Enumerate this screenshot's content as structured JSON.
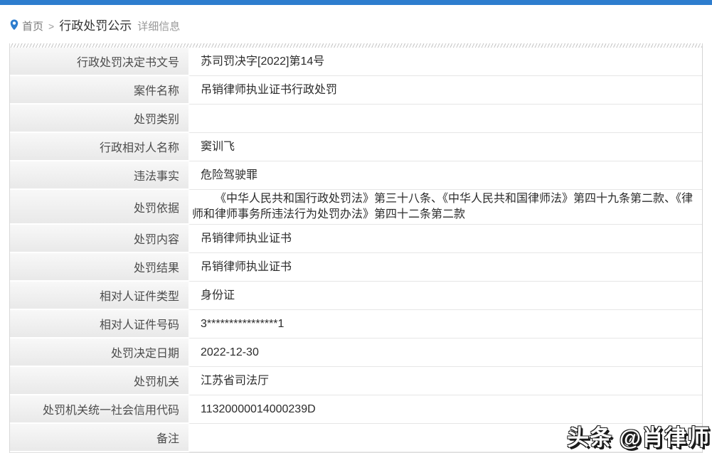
{
  "colors": {
    "topbar": "#2d7dce",
    "accent": "#2d7dce",
    "label_text": "#4c4c4c",
    "value_text": "#2b2b2b"
  },
  "breadcrumb": {
    "home": "首页",
    "separator": ">",
    "section": "行政处罚公示",
    "detail": "详细信息",
    "pin_icon": "location-pin"
  },
  "table": {
    "rows": [
      {
        "label": "行政处罚决定书文号",
        "value": "苏司罚决字[2022]第14号",
        "multiline": false
      },
      {
        "label": "案件名称",
        "value": "吊销律师执业证书行政处罚",
        "multiline": false
      },
      {
        "label": "处罚类别",
        "value": "",
        "multiline": false
      },
      {
        "label": "行政相对人名称",
        "value": "窦训飞",
        "multiline": false
      },
      {
        "label": "违法事实",
        "value": "危险驾驶罪",
        "multiline": false
      },
      {
        "label": "处罚依据",
        "value": "《中华人民共和国行政处罚法》第三十八条、《中华人民共和国律师法》第四十九条第二款、《律师和律师事务所违法行为处罚办法》第四十二条第二款",
        "multiline": true
      },
      {
        "label": "处罚内容",
        "value": "吊销律师执业证书",
        "multiline": false
      },
      {
        "label": "处罚结果",
        "value": "吊销律师执业证书",
        "multiline": false
      },
      {
        "label": "相对人证件类型",
        "value": "身份证",
        "multiline": false
      },
      {
        "label": "相对人证件号码",
        "value": "3****************1",
        "multiline": false
      },
      {
        "label": "处罚决定日期",
        "value": "2022-12-30",
        "multiline": false
      },
      {
        "label": "处罚机关",
        "value": "江苏省司法厅",
        "multiline": false
      },
      {
        "label": "处罚机关统一社会信用代码",
        "value": "11320000014000239D",
        "multiline": false
      },
      {
        "label": "备注",
        "value": "",
        "multiline": false
      }
    ]
  },
  "watermark": "头条 @肖律师"
}
